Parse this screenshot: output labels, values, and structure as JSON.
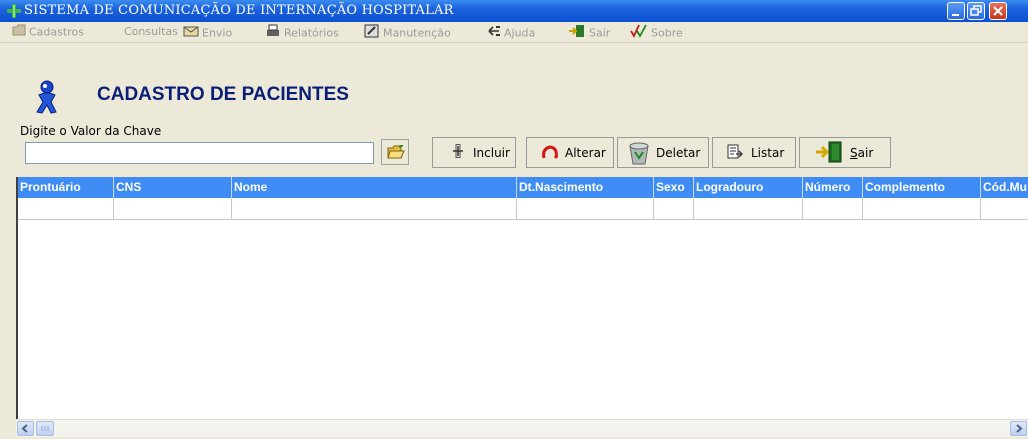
{
  "window": {
    "title": "SISTEMA DE COMUNICAÇÃO DE INTERNAÇÃO HOSPITALAR"
  },
  "menu": [
    {
      "label": "Cadastros",
      "icon": "folder-icon"
    },
    {
      "label": "Consultas",
      "icon": ""
    },
    {
      "label": "Envio",
      "icon": "send-icon"
    },
    {
      "label": "Relatórios",
      "icon": "printer-icon"
    },
    {
      "label": "Manutenção",
      "icon": "maintenance-icon"
    },
    {
      "label": "Ajuda",
      "icon": "help-icon"
    },
    {
      "label": "Sair",
      "icon": "exit-icon"
    },
    {
      "label": "Sobre",
      "icon": "check-icon"
    }
  ],
  "page": {
    "title": "CADASTRO DE PACIENTES"
  },
  "search": {
    "label": "Digite o Valor da Chave",
    "value": ""
  },
  "toolbar": {
    "incluir": "Incluir",
    "alterar": "Alterar",
    "deletar": "Deletar",
    "listar": "Listar",
    "sair_prefix": "S",
    "sair_rest": "air"
  },
  "table": {
    "columns": [
      "Prontuário",
      "CNS",
      "Nome",
      "Dt.Nascimento",
      "Sexo",
      "Logradouro",
      "Número",
      "Complemento",
      "Cód.Mu"
    ],
    "rows": [
      [
        "",
        "",
        "",
        "",
        "",
        "",
        "",
        "",
        ""
      ]
    ]
  },
  "colors": {
    "title_bar": "#1c63dc",
    "grid_header": "#3e8cf4",
    "page_title": "#0a1e78"
  }
}
